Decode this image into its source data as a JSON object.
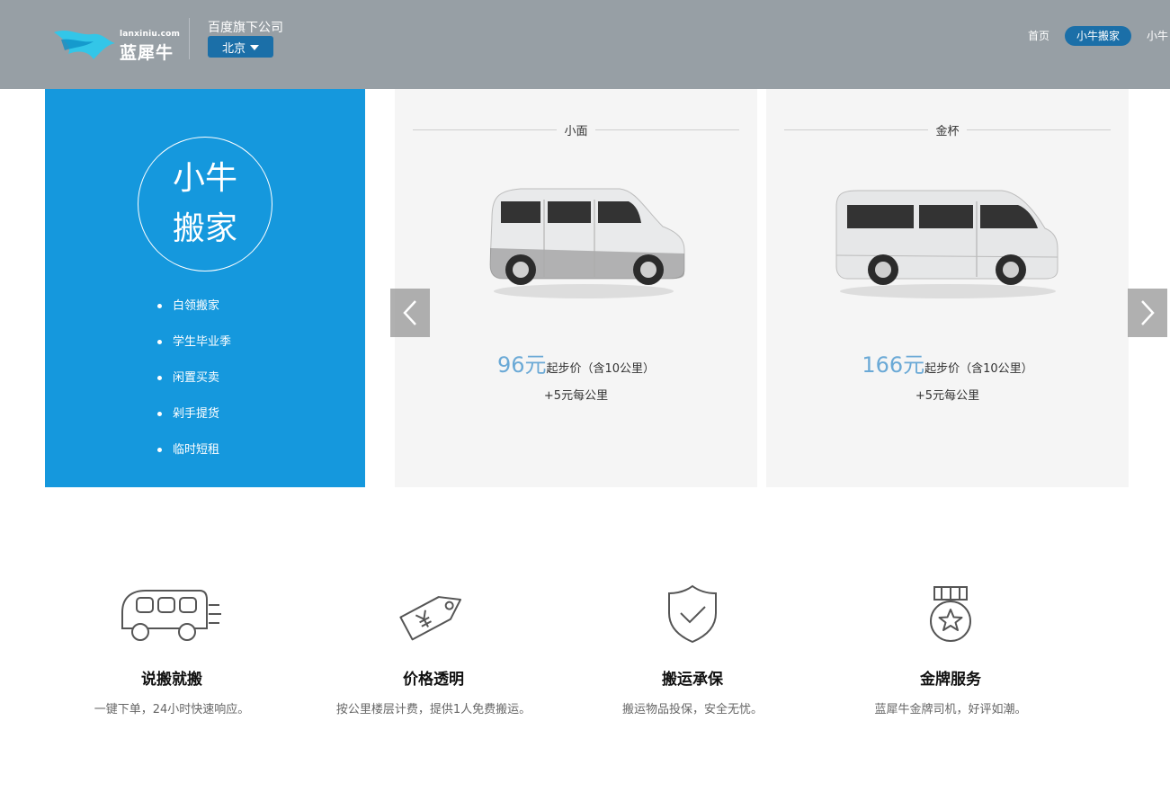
{
  "header": {
    "logo_url_text": "lanxiniu.com",
    "logo_name": "蓝犀牛",
    "company": "百度旗下公司",
    "city": "北京",
    "nav": [
      "首页",
      "小牛搬家",
      "小牛"
    ],
    "active_nav_index": 1,
    "colors": {
      "header_bg": "#979fa5",
      "accent": "#1b6fa8"
    }
  },
  "service": {
    "title_line1": "小牛",
    "title_line2": "搬家",
    "items": [
      "白领搬家",
      "学生毕业季",
      "闲置买卖",
      "剁手提货",
      "临时短租"
    ],
    "panel_color": "#1598dd"
  },
  "vehicles": [
    {
      "name": "小面",
      "price": "96元",
      "price_note": "起步价（含10公里）",
      "per_km": "+5元每公里",
      "icon": "minivan-image"
    },
    {
      "name": "金杯",
      "price": "166元",
      "price_note": "起步价（含10公里）",
      "per_km": "+5元每公里",
      "icon": "van-image"
    }
  ],
  "features": [
    {
      "icon": "truck-icon",
      "title": "说搬就搬",
      "desc": "一键下单，24小时快速响应。"
    },
    {
      "icon": "price-tag-icon",
      "title": "价格透明",
      "desc": "按公里楼层计费，提供1人免费搬运。"
    },
    {
      "icon": "shield-check-icon",
      "title": "搬运承保",
      "desc": "搬运物品投保，安全无忧。"
    },
    {
      "icon": "medal-icon",
      "title": "金牌服务",
      "desc": "蓝犀牛金牌司机，好评如潮。"
    }
  ]
}
